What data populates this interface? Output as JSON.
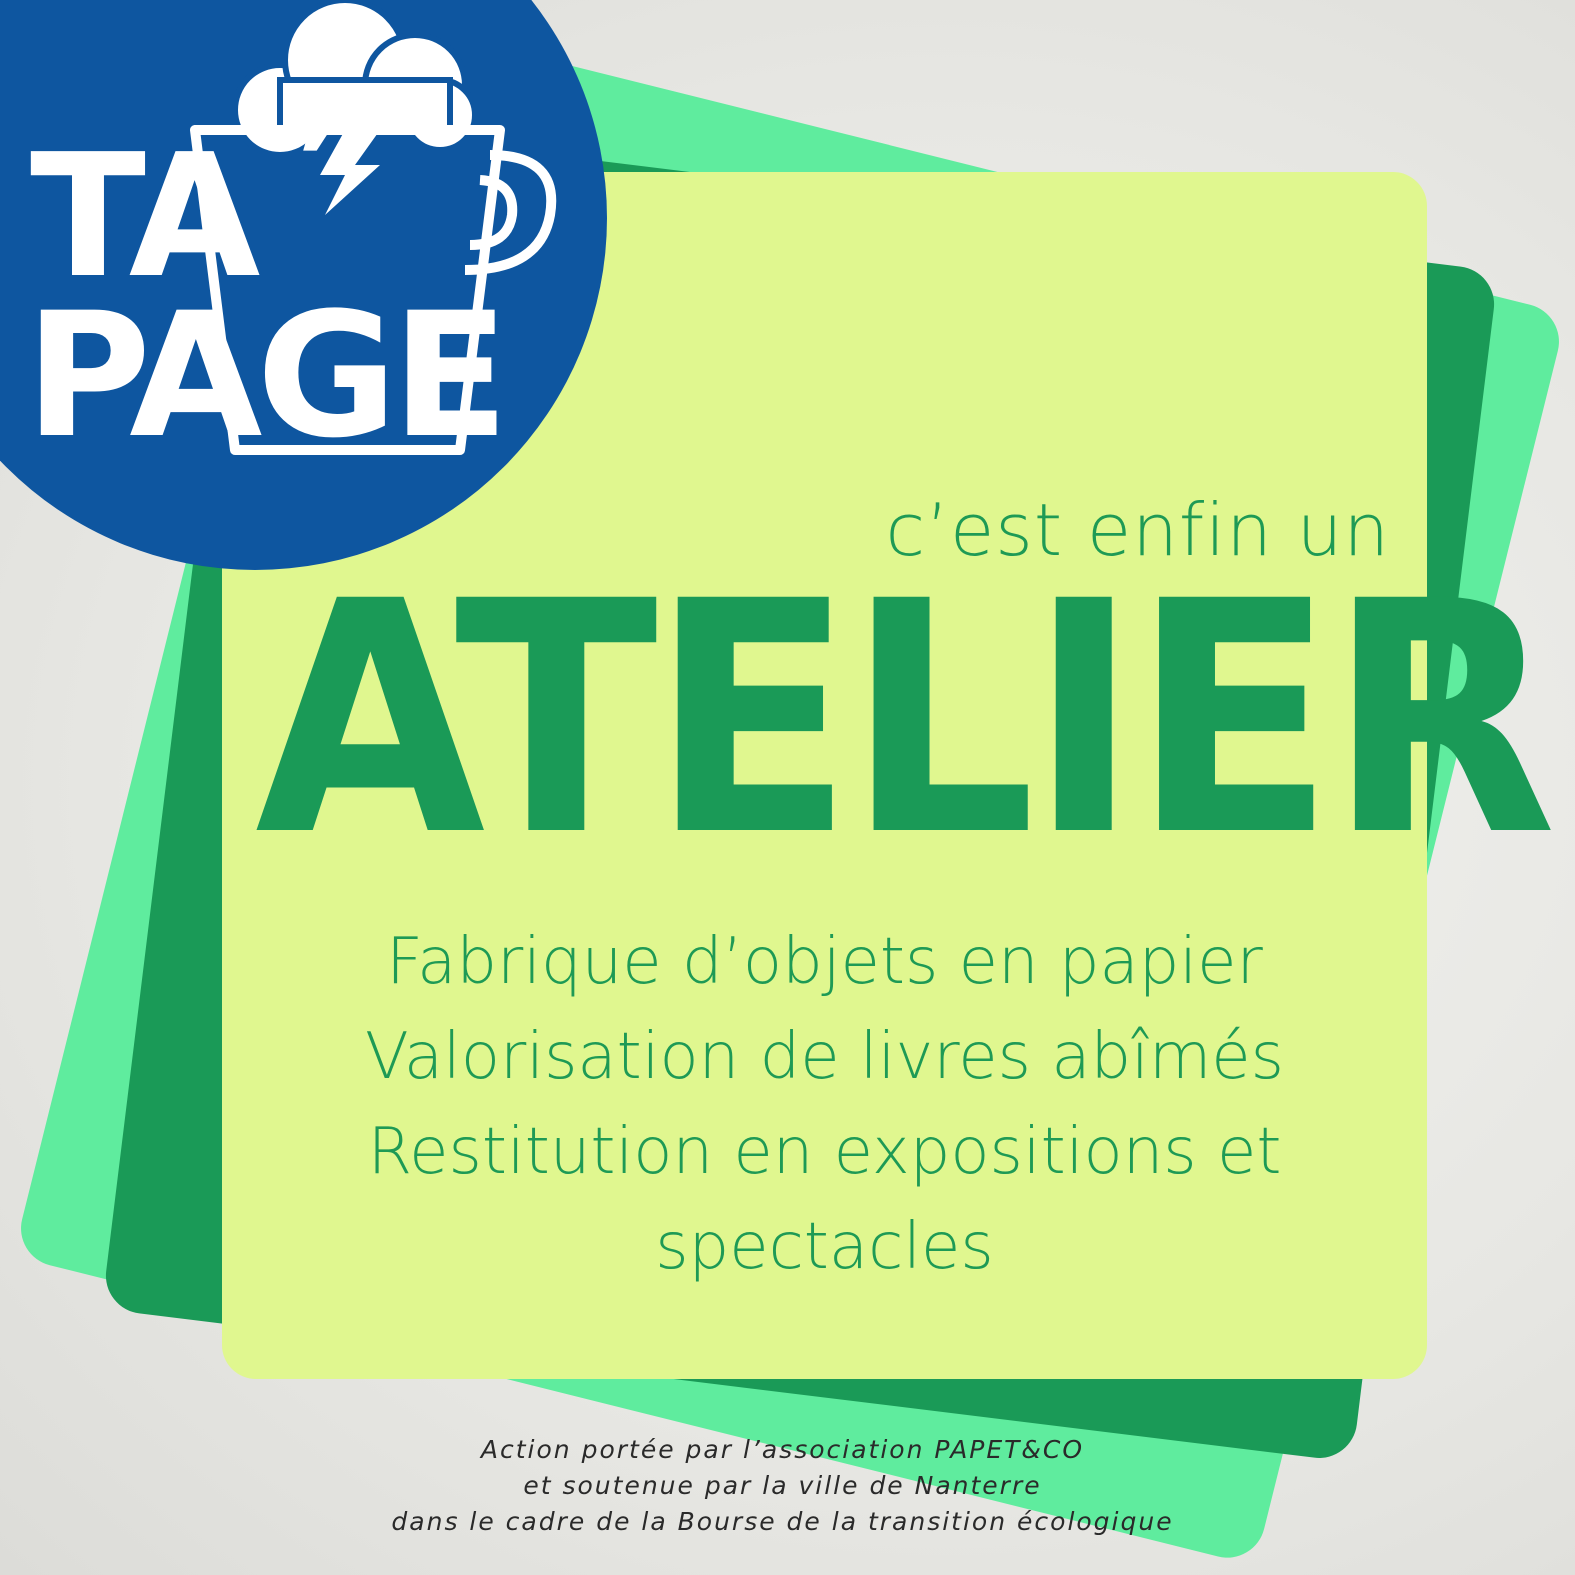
{
  "logo": {
    "line1": "TA",
    "line1_mark": "’",
    "line2": "PAGE",
    "colors": {
      "circle": "#0e56a0",
      "text": "#ffffff"
    }
  },
  "poster": {
    "tagline": "c’est enfin un",
    "headline": "ATELIER",
    "features": [
      "Fabrique d’objets en papier",
      "Valorisation de livres abîmés",
      "Restitution en expositions et",
      "spectacles"
    ],
    "credits": [
      "Action portée par l’association PAPET&CO",
      "et soutenue par la ville de Nanterre",
      "dans le cadre de la Bourse de la transition écologique"
    ]
  },
  "colors": {
    "card_main": "#e0f78f",
    "card_dark": "#1a9a57",
    "card_light": "#5fec9e",
    "text_green": "#1e9a55"
  },
  "icons": [
    "cloud-icon",
    "cup-icon",
    "lightning-icon"
  ]
}
